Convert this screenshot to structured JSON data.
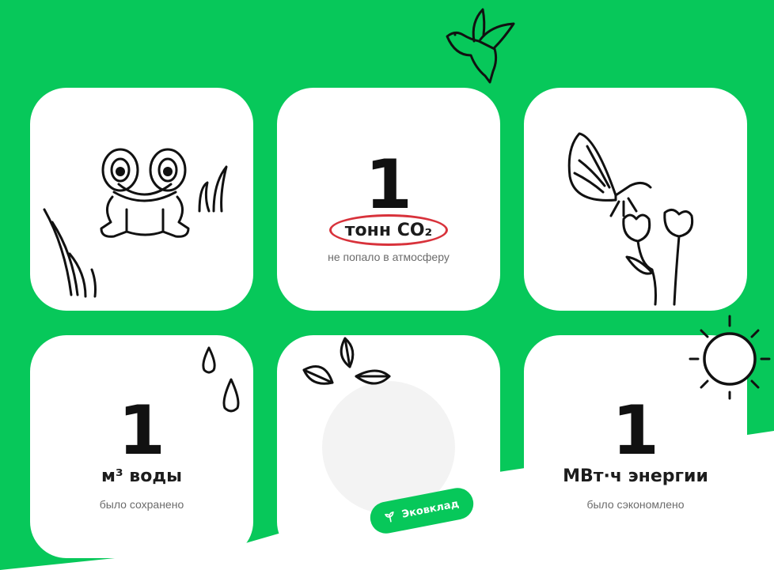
{
  "cards": [
    {
      "id": "frog",
      "icon": "frog-illustration"
    },
    {
      "id": "co2",
      "value": "1",
      "unit": "тонн CO₂",
      "caption": "не попало в атмосферу"
    },
    {
      "id": "butterfly",
      "icon": "butterfly-flowers-illustration"
    },
    {
      "id": "water",
      "value": "1",
      "unit": "м³ воды",
      "caption": "было сохранено"
    },
    {
      "id": "eco",
      "icon": "leaves-illustration",
      "button_label": "Эковклад"
    },
    {
      "id": "energy",
      "value": "1",
      "unit": "МВт·ч энергии",
      "caption": "было сэкономлено"
    }
  ],
  "colors": {
    "accent": "#07c85a",
    "highlight": "#d8323b"
  }
}
